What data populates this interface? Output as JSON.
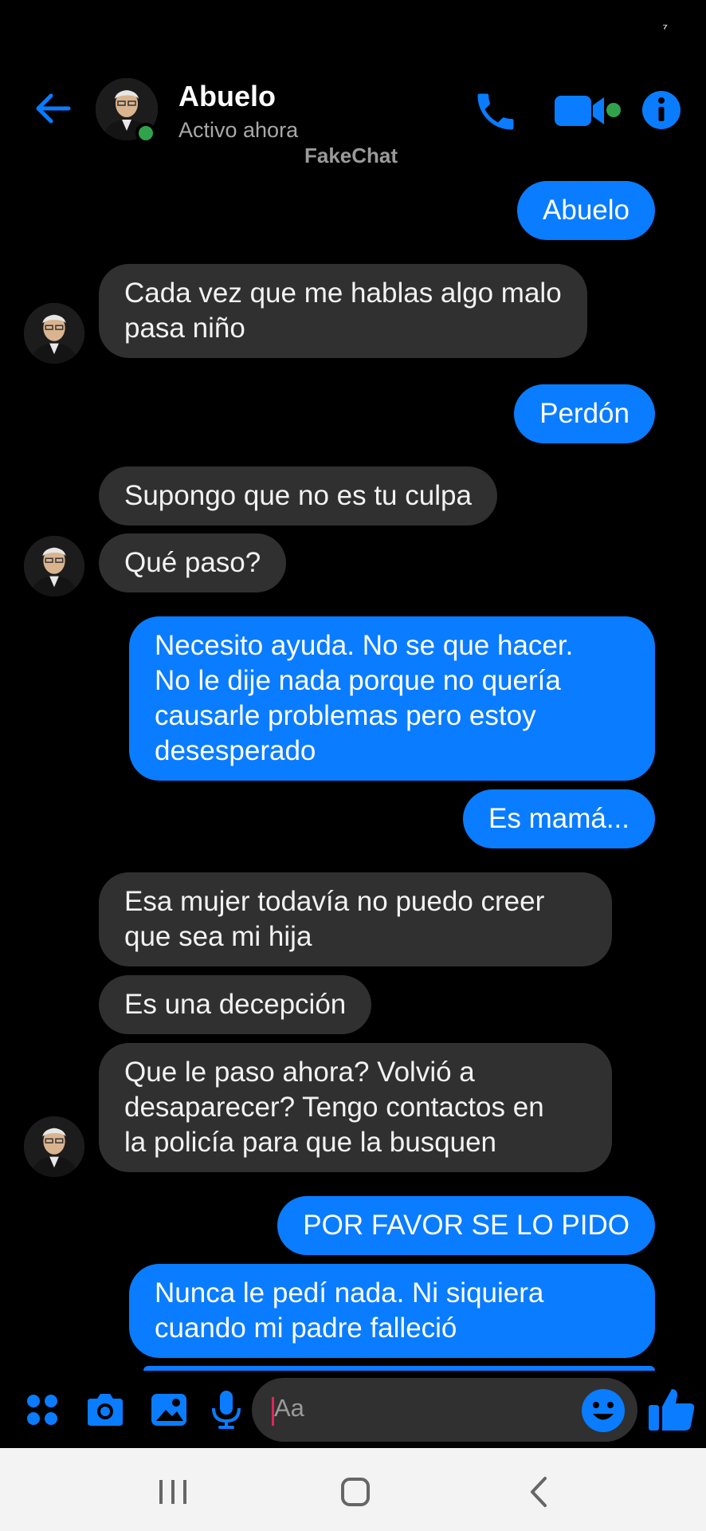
{
  "status_mark": "⁷",
  "header": {
    "contact_name": "Abuelo",
    "contact_status": "Activo ahora",
    "watermark": "FakeChat",
    "accent_color": "#0a7cff",
    "online_color": "#31a24c",
    "icons": [
      "back-arrow-icon",
      "phone-icon",
      "video-camera-icon",
      "info-icon"
    ]
  },
  "messages": [
    {
      "sender": "me",
      "lines": [
        "Abuelo"
      ]
    },
    {
      "sender": "Abuelo",
      "lines": [
        "Cada vez que me hablas algo malo",
        "pasa niño"
      ]
    },
    {
      "sender": "me",
      "lines": [
        "Perdón"
      ]
    },
    {
      "sender": "Abuelo",
      "lines": [
        "Supongo que no es tu culpa"
      ]
    },
    {
      "sender": "Abuelo",
      "lines": [
        "Qué paso?"
      ]
    },
    {
      "sender": "me",
      "lines": [
        "Necesito ayuda. No se que hacer.",
        "No le dije nada porque no quería",
        "causarle problemas pero estoy",
        "desesperado"
      ]
    },
    {
      "sender": "me",
      "lines": [
        "Es mamá..."
      ]
    },
    {
      "sender": "Abuelo",
      "lines": [
        "Esa mujer todavía no puedo creer",
        "que sea mi hija"
      ]
    },
    {
      "sender": "Abuelo",
      "lines": [
        "Es una decepción"
      ]
    },
    {
      "sender": "Abuelo",
      "lines": [
        "Que le paso ahora? Volvió a",
        "desaparecer? Tengo contactos en",
        "la policía para que la busquen"
      ]
    },
    {
      "sender": "me",
      "lines": [
        "POR FAVOR SE LO PIDO"
      ]
    },
    {
      "sender": "me",
      "lines": [
        "Nunca le pedí nada. Ni siquiera",
        "cuando mi padre falleció"
      ]
    }
  ],
  "composer": {
    "placeholder": "Aa",
    "icons": [
      "apps-grid-icon",
      "camera-icon",
      "gallery-icon",
      "microphone-icon",
      "emoji-icon",
      "thumbs-up-icon"
    ]
  },
  "navbar": {
    "icons": [
      "recent-apps-icon",
      "home-icon",
      "back-icon"
    ]
  }
}
